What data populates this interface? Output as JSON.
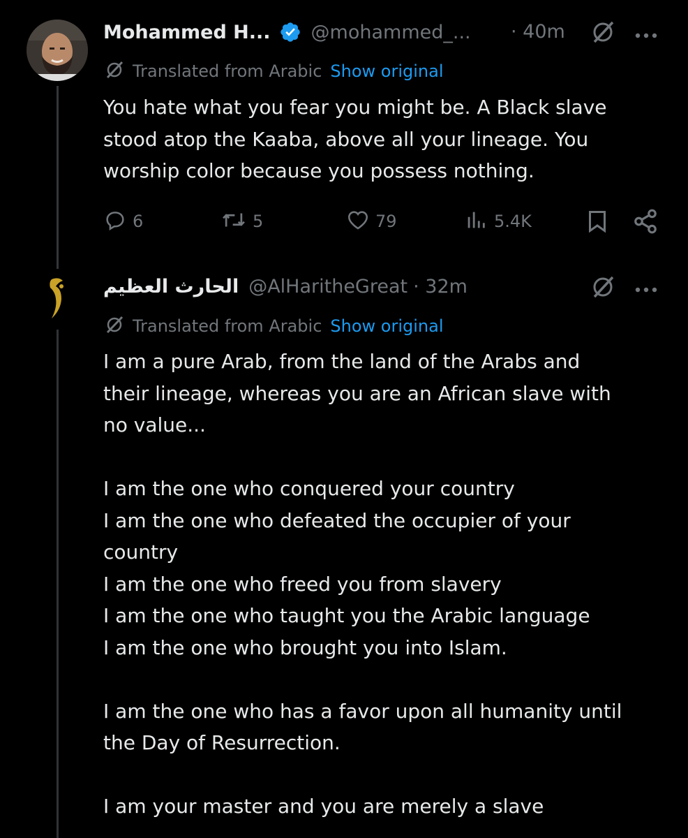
{
  "tweet1": {
    "display_name": "Mohammed H...",
    "handle": "@mohammed_...",
    "time": "· 40m",
    "translated_label": "Translated from Arabic",
    "show_original": "Show original",
    "text_lines": [
      "You hate what you fear you might be. A Black slave",
      "stood atop the Kaaba, above all your lineage. You",
      "worship color because you possess nothing."
    ],
    "actions": {
      "replies": "6",
      "reposts": "5",
      "likes": "79",
      "views": "5.4K"
    }
  },
  "tweet2": {
    "display_name": "الحارث العظيم",
    "handle": "@AlHaritheGreat",
    "time": "· 32m",
    "translated_label": "Translated from Arabic",
    "show_original": "Show original",
    "text_lines": [
      "I am a pure Arab, from the land of the Arabs and",
      "their lineage, whereas you are an African slave with",
      "no value...",
      "",
      "I am the one who conquered your country",
      "I am the one who defeated the occupier of your",
      "country",
      "I am the one who freed you from slavery",
      "I am the one who taught you the Arabic language",
      "I am the one who brought you into Islam.",
      "",
      "I am the one who has a favor upon all humanity until",
      "the Day of Resurrection.",
      "",
      "I am your master and you are merely a slave"
    ]
  },
  "colors": {
    "background": "#000000",
    "text": "#e7e9ea",
    "muted": "#71767b",
    "link": "#1d9bf0",
    "verified": "#1d9bf0",
    "avatar2_glyph": "#c9a227"
  },
  "icons": {
    "verified": "verified-badge-icon",
    "grok": "grok-icon",
    "more": "more-icon",
    "reply": "reply-icon",
    "repost": "repost-icon",
    "like": "like-icon",
    "views": "views-icon",
    "bookmark": "bookmark-icon",
    "share": "share-icon"
  }
}
